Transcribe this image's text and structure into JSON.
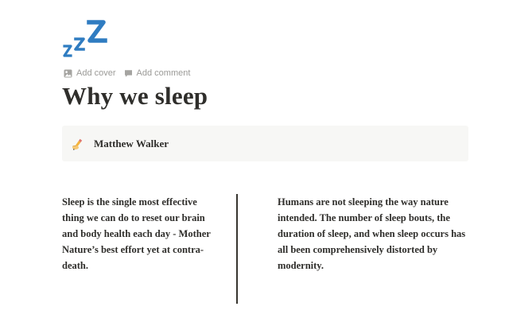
{
  "page": {
    "icon": "zzz-icon",
    "title": "Why we sleep"
  },
  "actions": [
    {
      "label": "Add cover",
      "icon": "image-icon"
    },
    {
      "label": "Add comment",
      "icon": "comment-icon"
    }
  ],
  "callout": {
    "icon": "writing-hand-icon",
    "text": "Matthew Walker"
  },
  "columns": [
    {
      "text": "Sleep is the single most effective thing we can do to reset our brain and body health each day - Mother Nature’s best effort yet at contra-death."
    },
    {
      "text": "Humans are not sleeping the way nature intended. The number of sleep bouts, the duration of sleep, and when sleep occurs has all been comprehensively distorted by modernity."
    }
  ],
  "colors": {
    "icon_blue": "#2f7cc1",
    "text": "#2f2e2b",
    "muted": "#9b9a97",
    "callout_bg": "#f7f7f5"
  }
}
